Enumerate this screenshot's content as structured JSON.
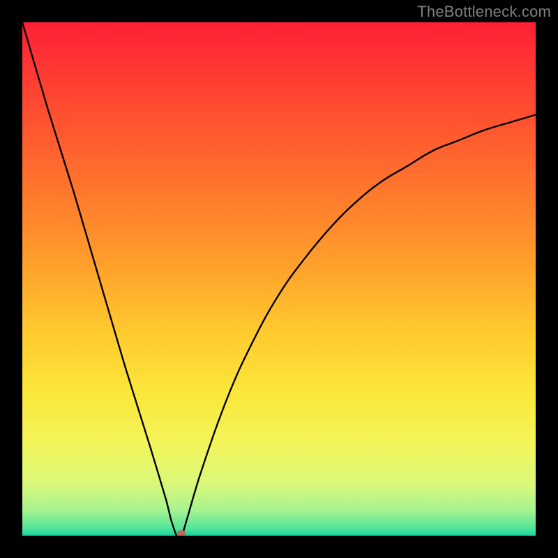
{
  "watermark": "TheBottleneck.com",
  "chart_data": {
    "type": "line",
    "title": "",
    "xlabel": "",
    "ylabel": "",
    "xlim": [
      0,
      100
    ],
    "ylim": [
      0,
      100
    ],
    "x_min_at": 30,
    "marker": {
      "x": 31,
      "y": 0,
      "color": "#c06a5a"
    },
    "curve_samples": {
      "x": [
        0,
        5,
        10,
        15,
        20,
        25,
        28,
        29,
        30,
        31,
        32,
        35,
        40,
        45,
        50,
        55,
        60,
        65,
        70,
        75,
        80,
        85,
        90,
        95,
        100
      ],
      "y": [
        100,
        83,
        67,
        50,
        33,
        17,
        7,
        3,
        0,
        0,
        3,
        13,
        27,
        38,
        47,
        54,
        60,
        65,
        69,
        72,
        75,
        77,
        79,
        80.5,
        82
      ]
    },
    "gradient_stops": [
      {
        "offset": 0.0,
        "color": "#ff1f36"
      },
      {
        "offset": 0.1,
        "color": "#ff3a33"
      },
      {
        "offset": 0.22,
        "color": "#ff5a2f"
      },
      {
        "offset": 0.35,
        "color": "#ff7d2c"
      },
      {
        "offset": 0.48,
        "color": "#ffa22b"
      },
      {
        "offset": 0.6,
        "color": "#ffc92e"
      },
      {
        "offset": 0.72,
        "color": "#fbe63a"
      },
      {
        "offset": 0.82,
        "color": "#f3f55a"
      },
      {
        "offset": 0.9,
        "color": "#d9f87a"
      },
      {
        "offset": 0.95,
        "color": "#a6f48f"
      },
      {
        "offset": 0.985,
        "color": "#55e59b"
      },
      {
        "offset": 1.0,
        "color": "#17d49f"
      }
    ]
  }
}
